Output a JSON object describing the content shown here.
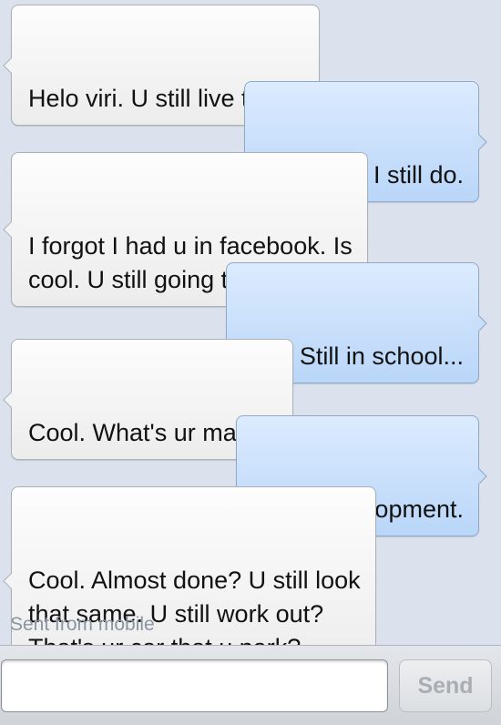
{
  "messages": [
    {
      "side": "in",
      "text": "Helo viri. U still live there."
    },
    {
      "side": "out",
      "text": "Haha yea I still do."
    },
    {
      "side": "in",
      "text": "I forgot I had u in facebook. Is\ncool. U still going to school?"
    },
    {
      "side": "out",
      "text": "Yup. Still in school..."
    },
    {
      "side": "in",
      "text": "Cool. What's ur major?"
    },
    {
      "side": "out",
      "text": "Child development."
    },
    {
      "side": "in",
      "text": "Cool. Almost done? U still look\nthat same. U still work out?\nThat's ur car that u park?"
    }
  ],
  "status": {
    "sent_from": "Sent from mobile"
  },
  "composer": {
    "value": "",
    "send_label": "Send"
  }
}
